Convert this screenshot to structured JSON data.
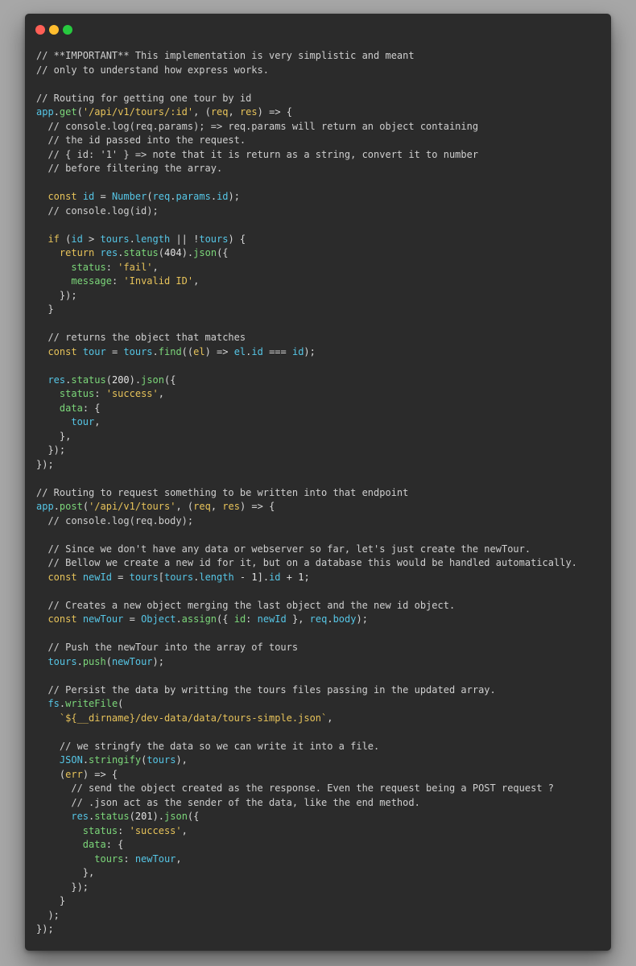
{
  "window": {
    "controls": [
      {
        "name": "close",
        "color": "#ff5f56"
      },
      {
        "name": "minimize",
        "color": "#ffbd2e"
      },
      {
        "name": "zoom",
        "color": "#27c93f"
      }
    ],
    "background": "#2b2b2b"
  },
  "palette": {
    "comment": "#cfcfcf",
    "plain": "#d7d7d7",
    "keyword": "#e7c35a",
    "string": "#e7c35a",
    "identifier": "#56c6e6",
    "property": "#7cd77a"
  },
  "code_lines": [
    [
      [
        "comment",
        "// **IMPORTANT** This implementation is very simplistic and meant"
      ]
    ],
    [
      [
        "comment",
        "// only to understand how express works."
      ]
    ],
    [],
    [
      [
        "comment",
        "// Routing for getting one tour by id"
      ]
    ],
    [
      [
        "ident",
        "app"
      ],
      [
        "plain",
        "."
      ],
      [
        "prop",
        "get"
      ],
      [
        "plain",
        "("
      ],
      [
        "string",
        "'/api/v1/tours/:id'"
      ],
      [
        "plain",
        ", ("
      ],
      [
        "param",
        "req"
      ],
      [
        "plain",
        ", "
      ],
      [
        "param",
        "res"
      ],
      [
        "plain",
        ") => {"
      ]
    ],
    [
      [
        "comment",
        "  // console.log(req.params); => req.params will return an object containing"
      ]
    ],
    [
      [
        "comment",
        "  // the id passed into the request."
      ]
    ],
    [
      [
        "comment",
        "  // { id: '1' } => note that it is return as a string, convert it to number"
      ]
    ],
    [
      [
        "comment",
        "  // before filtering the array."
      ]
    ],
    [],
    [
      [
        "plain",
        "  "
      ],
      [
        "keyword",
        "const"
      ],
      [
        "plain",
        " "
      ],
      [
        "ident",
        "id"
      ],
      [
        "plain",
        " = "
      ],
      [
        "ident",
        "Number"
      ],
      [
        "plain",
        "("
      ],
      [
        "ident",
        "req"
      ],
      [
        "plain",
        "."
      ],
      [
        "ident",
        "params"
      ],
      [
        "plain",
        "."
      ],
      [
        "ident",
        "id"
      ],
      [
        "plain",
        ");"
      ]
    ],
    [
      [
        "comment",
        "  // console.log(id);"
      ]
    ],
    [],
    [
      [
        "plain",
        "  "
      ],
      [
        "keyword",
        "if"
      ],
      [
        "plain",
        " ("
      ],
      [
        "ident",
        "id"
      ],
      [
        "plain",
        " > "
      ],
      [
        "ident",
        "tours"
      ],
      [
        "plain",
        "."
      ],
      [
        "ident",
        "length"
      ],
      [
        "plain",
        " || !"
      ],
      [
        "ident",
        "tours"
      ],
      [
        "plain",
        ") {"
      ]
    ],
    [
      [
        "plain",
        "    "
      ],
      [
        "keyword",
        "return"
      ],
      [
        "plain",
        " "
      ],
      [
        "ident",
        "res"
      ],
      [
        "plain",
        "."
      ],
      [
        "prop",
        "status"
      ],
      [
        "plain",
        "("
      ],
      [
        "number",
        "404"
      ],
      [
        "plain",
        ")."
      ],
      [
        "prop",
        "json"
      ],
      [
        "plain",
        "({"
      ]
    ],
    [
      [
        "plain",
        "      "
      ],
      [
        "prop",
        "status"
      ],
      [
        "plain",
        ": "
      ],
      [
        "string",
        "'fail'"
      ],
      [
        "plain",
        ","
      ]
    ],
    [
      [
        "plain",
        "      "
      ],
      [
        "prop",
        "message"
      ],
      [
        "plain",
        ": "
      ],
      [
        "string",
        "'Invalid ID'"
      ],
      [
        "plain",
        ","
      ]
    ],
    [
      [
        "plain",
        "    });"
      ]
    ],
    [
      [
        "plain",
        "  }"
      ]
    ],
    [],
    [
      [
        "comment",
        "  // returns the object that matches"
      ]
    ],
    [
      [
        "plain",
        "  "
      ],
      [
        "keyword",
        "const"
      ],
      [
        "plain",
        " "
      ],
      [
        "ident",
        "tour"
      ],
      [
        "plain",
        " = "
      ],
      [
        "ident",
        "tours"
      ],
      [
        "plain",
        "."
      ],
      [
        "prop",
        "find"
      ],
      [
        "plain",
        "(("
      ],
      [
        "param",
        "el"
      ],
      [
        "plain",
        ") => "
      ],
      [
        "ident",
        "el"
      ],
      [
        "plain",
        "."
      ],
      [
        "ident",
        "id"
      ],
      [
        "plain",
        " === "
      ],
      [
        "ident",
        "id"
      ],
      [
        "plain",
        ");"
      ]
    ],
    [],
    [
      [
        "plain",
        "  "
      ],
      [
        "ident",
        "res"
      ],
      [
        "plain",
        "."
      ],
      [
        "prop",
        "status"
      ],
      [
        "plain",
        "("
      ],
      [
        "number",
        "200"
      ],
      [
        "plain",
        ")."
      ],
      [
        "prop",
        "json"
      ],
      [
        "plain",
        "({"
      ]
    ],
    [
      [
        "plain",
        "    "
      ],
      [
        "prop",
        "status"
      ],
      [
        "plain",
        ": "
      ],
      [
        "string",
        "'success'"
      ],
      [
        "plain",
        ","
      ]
    ],
    [
      [
        "plain",
        "    "
      ],
      [
        "prop",
        "data"
      ],
      [
        "plain",
        ": {"
      ]
    ],
    [
      [
        "plain",
        "      "
      ],
      [
        "ident",
        "tour"
      ],
      [
        "plain",
        ","
      ]
    ],
    [
      [
        "plain",
        "    },"
      ]
    ],
    [
      [
        "plain",
        "  });"
      ]
    ],
    [
      [
        "plain",
        "});"
      ]
    ],
    [],
    [
      [
        "comment",
        "// Routing to request something to be written into that endpoint"
      ]
    ],
    [
      [
        "ident",
        "app"
      ],
      [
        "plain",
        "."
      ],
      [
        "prop",
        "post"
      ],
      [
        "plain",
        "("
      ],
      [
        "string",
        "'/api/v1/tours'"
      ],
      [
        "plain",
        ", ("
      ],
      [
        "param",
        "req"
      ],
      [
        "plain",
        ", "
      ],
      [
        "param",
        "res"
      ],
      [
        "plain",
        ") => {"
      ]
    ],
    [
      [
        "comment",
        "  // console.log(req.body);"
      ]
    ],
    [],
    [
      [
        "comment",
        "  // Since we don't have any data or webserver so far, let's just create the newTour."
      ]
    ],
    [
      [
        "comment",
        "  // Bellow we create a new id for it, but on a database this would be handled automatically."
      ]
    ],
    [
      [
        "plain",
        "  "
      ],
      [
        "keyword",
        "const"
      ],
      [
        "plain",
        " "
      ],
      [
        "ident",
        "newId"
      ],
      [
        "plain",
        " = "
      ],
      [
        "ident",
        "tours"
      ],
      [
        "plain",
        "["
      ],
      [
        "ident",
        "tours"
      ],
      [
        "plain",
        "."
      ],
      [
        "ident",
        "length"
      ],
      [
        "plain",
        " - "
      ],
      [
        "number",
        "1"
      ],
      [
        "plain",
        "]."
      ],
      [
        "ident",
        "id"
      ],
      [
        "plain",
        " + "
      ],
      [
        "number",
        "1"
      ],
      [
        "plain",
        ";"
      ]
    ],
    [],
    [
      [
        "comment",
        "  // Creates a new object merging the last object and the new id object."
      ]
    ],
    [
      [
        "plain",
        "  "
      ],
      [
        "keyword",
        "const"
      ],
      [
        "plain",
        " "
      ],
      [
        "ident",
        "newTour"
      ],
      [
        "plain",
        " = "
      ],
      [
        "ident",
        "Object"
      ],
      [
        "plain",
        "."
      ],
      [
        "prop",
        "assign"
      ],
      [
        "plain",
        "({ "
      ],
      [
        "prop",
        "id"
      ],
      [
        "plain",
        ": "
      ],
      [
        "ident",
        "newId"
      ],
      [
        "plain",
        " }, "
      ],
      [
        "ident",
        "req"
      ],
      [
        "plain",
        "."
      ],
      [
        "ident",
        "body"
      ],
      [
        "plain",
        ");"
      ]
    ],
    [],
    [
      [
        "comment",
        "  // Push the newTour into the array of tours"
      ]
    ],
    [
      [
        "plain",
        "  "
      ],
      [
        "ident",
        "tours"
      ],
      [
        "plain",
        "."
      ],
      [
        "prop",
        "push"
      ],
      [
        "plain",
        "("
      ],
      [
        "ident",
        "newTour"
      ],
      [
        "plain",
        ");"
      ]
    ],
    [],
    [
      [
        "comment",
        "  // Persist the data by writting the tours files passing in the updated array."
      ]
    ],
    [
      [
        "plain",
        "  "
      ],
      [
        "ident",
        "fs"
      ],
      [
        "plain",
        "."
      ],
      [
        "prop",
        "writeFile"
      ],
      [
        "plain",
        "("
      ]
    ],
    [
      [
        "plain",
        "    "
      ],
      [
        "string",
        "`${__dirname}/dev-data/data/tours-simple.json`"
      ],
      [
        "plain",
        ","
      ]
    ],
    [],
    [
      [
        "comment",
        "    // we stringfy the data so we can write it into a file."
      ]
    ],
    [
      [
        "plain",
        "    "
      ],
      [
        "ident",
        "JSON"
      ],
      [
        "plain",
        "."
      ],
      [
        "prop",
        "stringify"
      ],
      [
        "plain",
        "("
      ],
      [
        "ident",
        "tours"
      ],
      [
        "plain",
        "),"
      ]
    ],
    [
      [
        "plain",
        "    ("
      ],
      [
        "param",
        "err"
      ],
      [
        "plain",
        ") => {"
      ]
    ],
    [
      [
        "comment",
        "      // send the object created as the response. Even the request being a POST request ?"
      ]
    ],
    [
      [
        "comment",
        "      // .json act as the sender of the data, like the end method."
      ]
    ],
    [
      [
        "plain",
        "      "
      ],
      [
        "ident",
        "res"
      ],
      [
        "plain",
        "."
      ],
      [
        "prop",
        "status"
      ],
      [
        "plain",
        "("
      ],
      [
        "number",
        "201"
      ],
      [
        "plain",
        ")."
      ],
      [
        "prop",
        "json"
      ],
      [
        "plain",
        "({"
      ]
    ],
    [
      [
        "plain",
        "        "
      ],
      [
        "prop",
        "status"
      ],
      [
        "plain",
        ": "
      ],
      [
        "string",
        "'success'"
      ],
      [
        "plain",
        ","
      ]
    ],
    [
      [
        "plain",
        "        "
      ],
      [
        "prop",
        "data"
      ],
      [
        "plain",
        ": {"
      ]
    ],
    [
      [
        "plain",
        "          "
      ],
      [
        "prop",
        "tours"
      ],
      [
        "plain",
        ": "
      ],
      [
        "ident",
        "newTour"
      ],
      [
        "plain",
        ","
      ]
    ],
    [
      [
        "plain",
        "        },"
      ]
    ],
    [
      [
        "plain",
        "      });"
      ]
    ],
    [
      [
        "plain",
        "    }"
      ]
    ],
    [
      [
        "plain",
        "  );"
      ]
    ],
    [
      [
        "plain",
        "});"
      ]
    ]
  ]
}
